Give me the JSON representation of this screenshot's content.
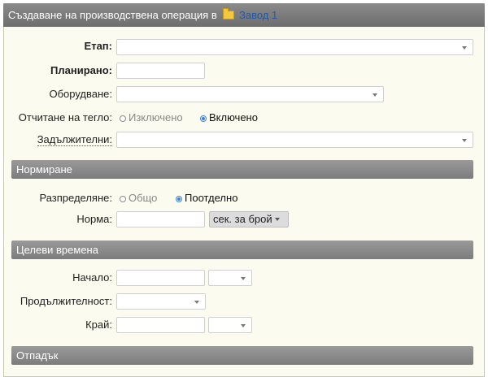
{
  "header": {
    "title_prefix": "Създаване на производствена операция в",
    "folder_link": "Завод 1"
  },
  "form": {
    "stage_label": "Етап",
    "planned_label": "Планирано",
    "equipment_label": "Оборудване:",
    "weight_label": "Отчитане на тегло:",
    "weight_options": [
      "Изключено",
      "Включено"
    ],
    "weight_selected": "Включено",
    "required_label": "Задължителни:"
  },
  "sections": {
    "norming": "Нормиране",
    "target_times": "Целеви времена",
    "waste": "Отпадък"
  },
  "norming": {
    "distribution_label": "Разпределяне:",
    "distribution_options": [
      "Общо",
      "Поотделно"
    ],
    "distribution_selected": "Поотделно",
    "norm_label": "Норма:",
    "unit_value": "сек. за брой"
  },
  "times": {
    "start_label": "Начало:",
    "duration_label": "Продължителност:",
    "end_label": "Край:"
  },
  "icons": {
    "folder": "folder-icon",
    "dropdown": "chevron-down-icon",
    "radio": "radio-icon"
  }
}
